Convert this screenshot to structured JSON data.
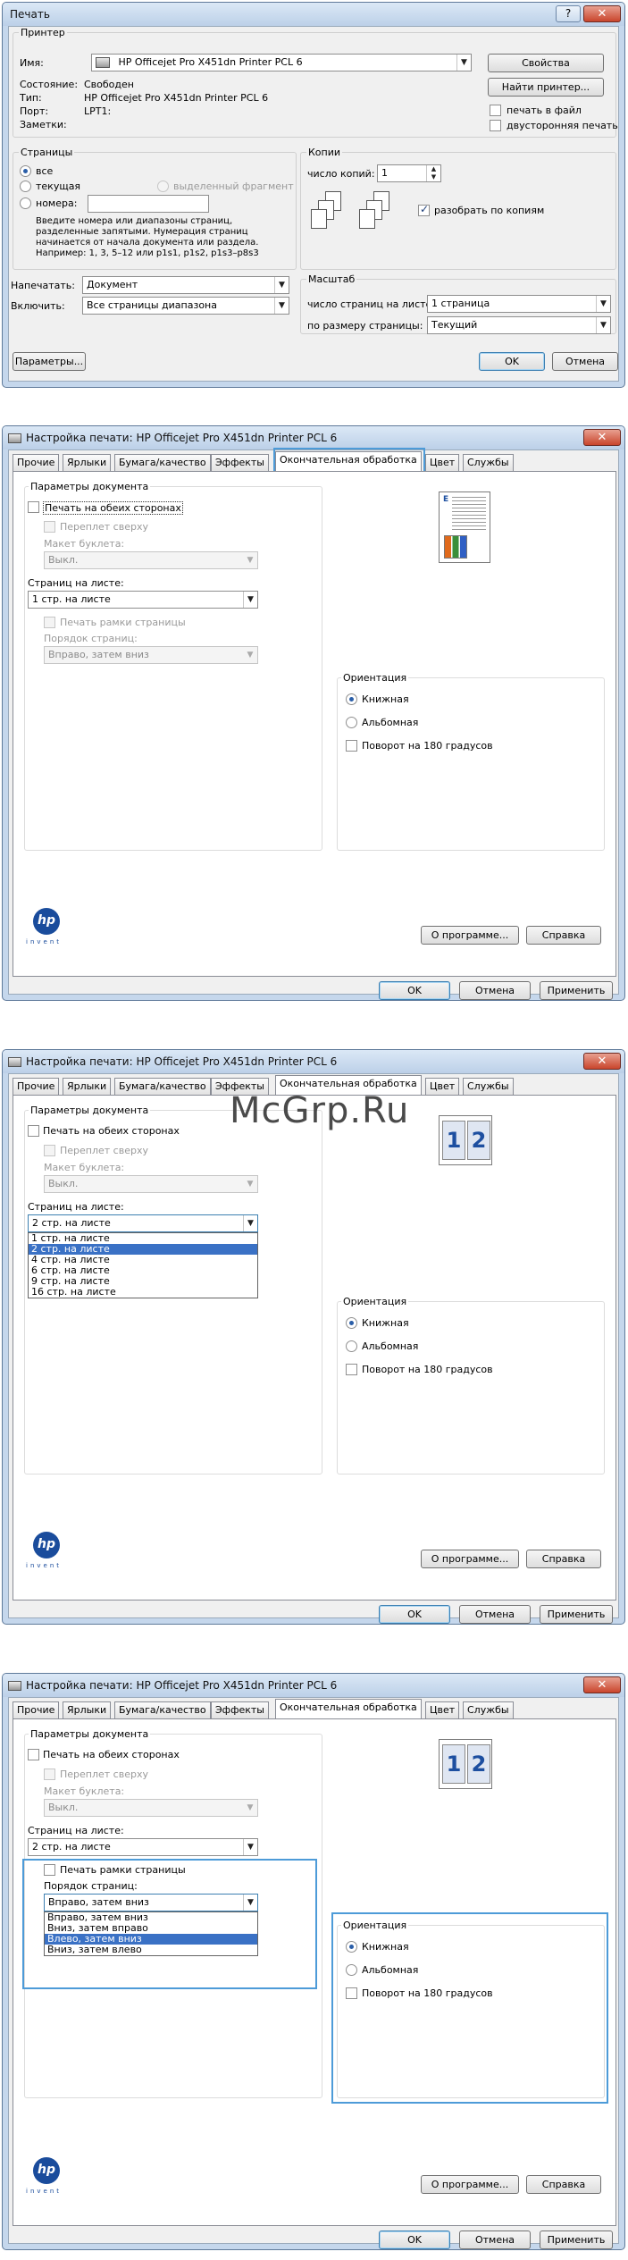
{
  "print_dialog": {
    "title": "Печать",
    "printer_group": "Принтер",
    "name_label": "Имя:",
    "printer_name": "HP Officejet Pro X451dn Printer PCL 6",
    "properties_button": "Свойства",
    "find_printer_button": "Найти принтер...",
    "status_label": "Состояние:",
    "status_value": "Свободен",
    "type_label": "Тип:",
    "type_value": "HP Officejet Pro X451dn Printer PCL 6",
    "port_label": "Порт:",
    "port_value": "LPT1:",
    "comment_label": "Заметки:",
    "print_to_file": "печать в файл",
    "duplex": "двусторонняя печать",
    "pages_group": "Страницы",
    "all": "все",
    "current": "текущая",
    "selection": "выделенный фрагмент",
    "numbers": "номера:",
    "hint": "Введите номера или диапазоны страниц, разделенные запятыми. Нумерация страниц начинается от начала документа или раздела. Например: 1, 3, 5–12 или p1s1, p1s2, p1s3–p8s3",
    "copies_group": "Копии",
    "copies_label": "число копий:",
    "copies_value": "1",
    "collate": "разобрать по копиям",
    "print_what_label": "Напечатать:",
    "print_what_value": "Документ",
    "include_label": "Включить:",
    "include_value": "Все страницы диапазона",
    "scale_group": "Масштаб",
    "pages_per_sheet_label": "число страниц на листе:",
    "pages_per_sheet_value": "1 страница",
    "scale_to_paper_label": "по размеру страницы:",
    "scale_to_paper_value": "Текущий",
    "options_button": "Параметры...",
    "ok_button": "OK",
    "cancel_button": "Отмена"
  },
  "prefs": {
    "title": "Настройка печати: HP Officejet Pro X451dn Printer PCL 6",
    "tabs": [
      "Прочие",
      "Ярлыки",
      "Бумага/качество",
      "Эффекты",
      "Окончательная обработка",
      "Цвет",
      "Службы"
    ],
    "doc_options": "Параметры документа",
    "both_sides": "Печать на обеих сторонах",
    "flip_up": "Переплет сверху",
    "booklet_label": "Макет буклета:",
    "booklet_value": "Выкл.",
    "pages_per_sheet_label": "Страниц на листе:",
    "page_borders": "Печать рамки страницы",
    "page_order_label": "Порядок страниц:",
    "page_order_value": "Вправо, затем вниз",
    "orientation": "Ориентация",
    "portrait": "Книжная",
    "landscape": "Альбомная",
    "rotate": "Поворот на 180 градусов",
    "about_button": "О программе...",
    "help_button": "Справка",
    "ok_button": "OK",
    "cancel_button": "Отмена",
    "apply_button": "Применить",
    "logo_text": "hp",
    "logo_sub": "invent",
    "preview_num_1": "1",
    "preview_num_2": "2"
  },
  "s2": {
    "pps_value": "1 стр. на листе"
  },
  "s3": {
    "pps_value": "2 стр. на листе",
    "options": [
      "1 стр. на листе",
      "2 стр. на листе",
      "4 стр. на листе",
      "6 стр. на листе",
      "9 стр. на листе",
      "16 стр. на листе"
    ]
  },
  "s4": {
    "pps_value": "2 стр. на листе",
    "order_options": [
      "Вправо, затем вниз",
      "Вниз, затем вправо",
      "Влево, затем вниз",
      "Вниз, затем влево"
    ]
  },
  "watermark": "McGrp.Ru",
  "colors": {
    "highlight": "#4d9bd8",
    "selection": "#3a71c5",
    "title_bar": "#c5d7ec"
  }
}
